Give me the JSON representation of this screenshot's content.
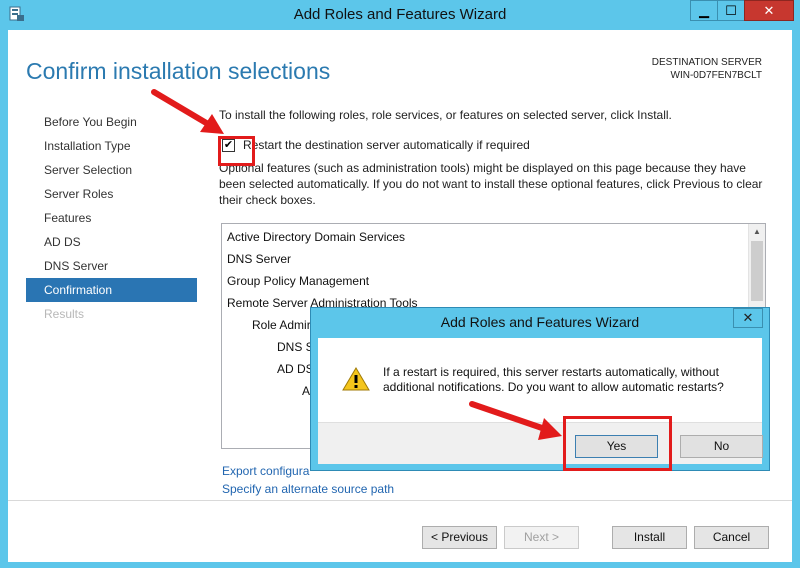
{
  "window": {
    "title": "Add Roles and Features Wizard",
    "controls": {
      "minimize": "▁",
      "maximize": "☐",
      "close": "✕"
    }
  },
  "page": {
    "title": "Confirm installation selections",
    "destination_label": "DESTINATION SERVER",
    "destination_server": "WIN-0D7FEN7BCLT"
  },
  "nav": {
    "items": [
      {
        "label": "Before You Begin"
      },
      {
        "label": "Installation Type"
      },
      {
        "label": "Server Selection"
      },
      {
        "label": "Server Roles"
      },
      {
        "label": "Features"
      },
      {
        "label": "AD DS"
      },
      {
        "label": "DNS Server"
      },
      {
        "label": "Confirmation"
      },
      {
        "label": "Results"
      }
    ]
  },
  "content": {
    "intro": "To install the following roles, role services, or features on selected server, click Install.",
    "restart_checkbox": {
      "label": "Restart the destination server automatically if required",
      "checked": true
    },
    "note": "Optional features (such as administration tools) might be displayed on this page because they have been selected automatically. If you do not want to install these optional features, click Previous to clear their check boxes.",
    "list": [
      {
        "label": "Active Directory Domain Services"
      },
      {
        "label": "DNS Server"
      },
      {
        "label": "Group Policy Management"
      },
      {
        "label": "Remote Server Administration Tools"
      },
      {
        "label": "Role Admir"
      },
      {
        "label": "DNS S"
      },
      {
        "label": "AD DS"
      },
      {
        "label": "A"
      }
    ],
    "export_link": "Export configura",
    "alt_source_link": "Specify an alternate source path"
  },
  "footer": {
    "previous": "< Previous",
    "next": "Next >",
    "install": "Install",
    "cancel": "Cancel"
  },
  "dialog": {
    "title": "Add Roles and Features Wizard",
    "close": "✕",
    "message": "If a restart is required, this server restarts automatically, without additional notifications. Do you want to allow automatic restarts?",
    "yes": "Yes",
    "no": "No"
  },
  "colors": {
    "accent": "#2b7ab0",
    "selection": "#2a75b3",
    "chrome": "#5cc6ea",
    "annotation": "#e21b1b"
  }
}
